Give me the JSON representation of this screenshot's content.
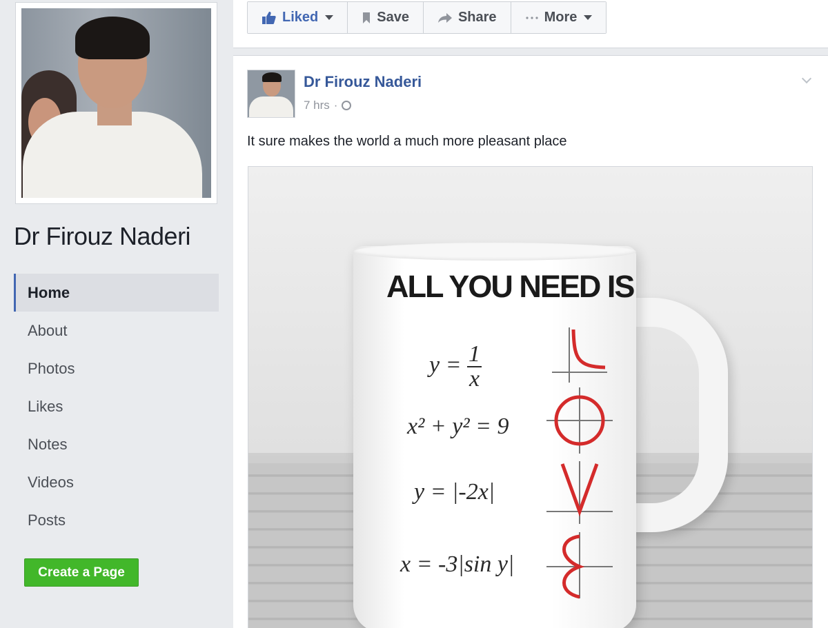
{
  "page": {
    "name": "Dr Firouz Naderi"
  },
  "sidebar": {
    "items": [
      {
        "label": "Home",
        "active": true
      },
      {
        "label": "About"
      },
      {
        "label": "Photos"
      },
      {
        "label": "Likes"
      },
      {
        "label": "Notes"
      },
      {
        "label": "Videos"
      },
      {
        "label": "Posts"
      }
    ],
    "create_page_label": "Create a Page"
  },
  "actions": {
    "liked_label": "Liked",
    "save_label": "Save",
    "share_label": "Share",
    "more_label": "More"
  },
  "post": {
    "author": "Dr Firouz Naderi",
    "time": "7 hrs",
    "separator": "·",
    "text": "It sure makes the world a much more pleasant place",
    "image": {
      "title": "ALL YOU NEED IS",
      "eq1_lhs": "y =",
      "eq1_num": "1",
      "eq1_den": "x",
      "eq2": "x² + y² = 9",
      "eq3": "y = |-2x|",
      "eq4": "x = -3|sin y|"
    }
  },
  "colors": {
    "link": "#365899",
    "accent": "#4267b2",
    "create_button": "#42b72a",
    "graph_red": "#d42b2b"
  }
}
